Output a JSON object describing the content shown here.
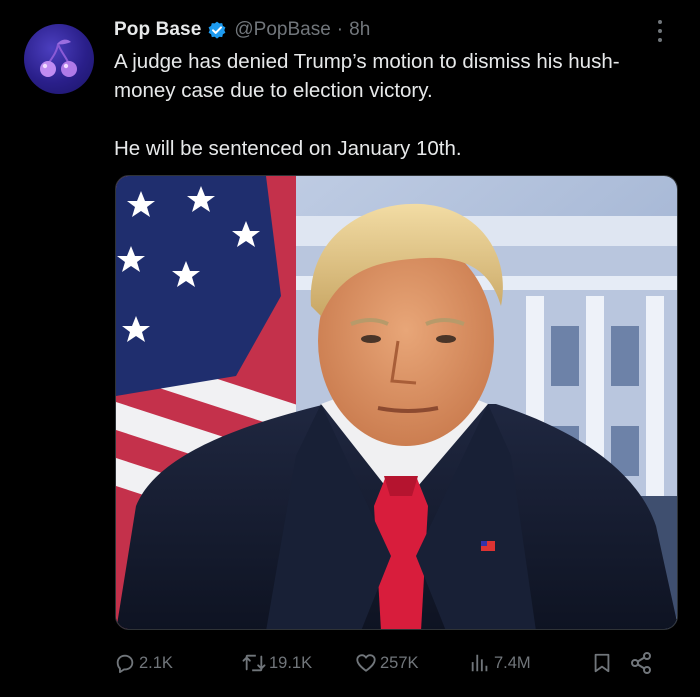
{
  "post": {
    "author": {
      "display_name": "Pop Base",
      "handle": "@PopBase",
      "separator": "·",
      "time": "8h",
      "verified": true,
      "avatar_icon": "cherries-icon"
    },
    "text": {
      "line1": "A judge has denied Trump’s motion to dismiss his hush-money case due to election victory.",
      "line2": "He will be sentenced on January 10th."
    },
    "media": {
      "type": "photo",
      "subject_icon": "portrait-photo"
    },
    "stats": {
      "replies": "2.1K",
      "reposts": "19.1K",
      "likes": "257K",
      "views": "7.4M"
    }
  },
  "colors": {
    "background": "#000000",
    "text_primary": "#e7e9ea",
    "text_secondary": "#71767b",
    "verified_blue": "#1d9bf0",
    "avatar_bg": "#2a1f8a"
  }
}
